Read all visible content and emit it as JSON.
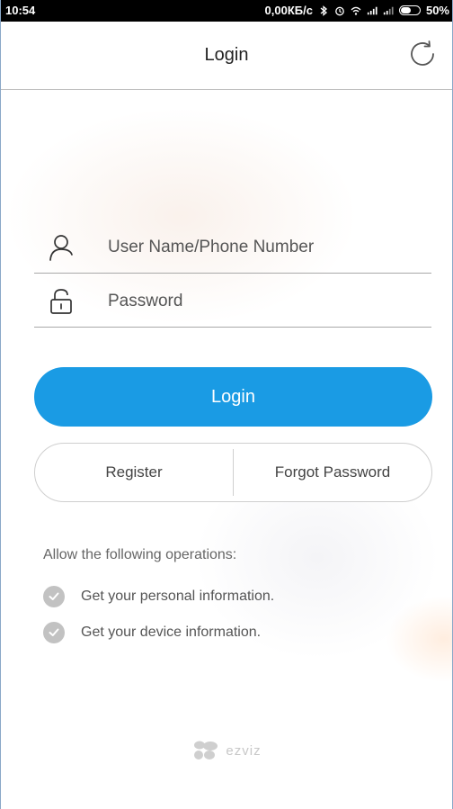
{
  "status_bar": {
    "time": "10:54",
    "net_speed": "0,00КБ/с",
    "battery": "50%"
  },
  "header": {
    "title": "Login",
    "refresh_icon": "refresh-icon"
  },
  "form": {
    "username_placeholder": "User Name/Phone Number",
    "password_placeholder": "Password",
    "login_label": "Login",
    "register_label": "Register",
    "forgot_label": "Forgot Password"
  },
  "permissions": {
    "title": "Allow the following operations:",
    "items": [
      "Get your personal information.",
      "Get your device information."
    ]
  },
  "brand": {
    "name": "ezviz"
  },
  "colors": {
    "primary": "#1a9be4",
    "check": "#c2c2c2"
  }
}
